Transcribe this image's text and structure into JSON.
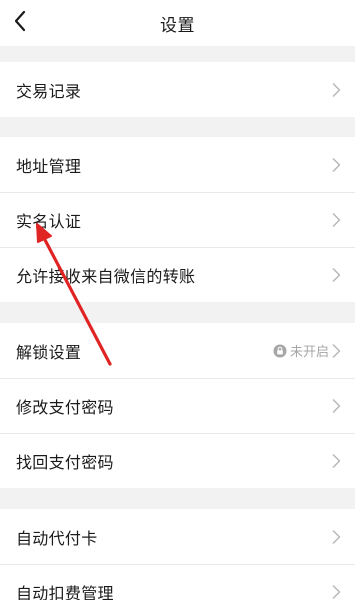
{
  "header": {
    "title": "设置",
    "back_icon": "chevron-left-icon"
  },
  "groups": [
    {
      "items": [
        {
          "label": "交易记录"
        }
      ]
    },
    {
      "items": [
        {
          "label": "地址管理"
        },
        {
          "label": "实名认证"
        },
        {
          "label": "允许接收来自微信的转账"
        }
      ]
    },
    {
      "items": [
        {
          "label": "解锁设置",
          "status": "未开启",
          "status_icon": "lock-icon"
        },
        {
          "label": "修改支付密码"
        },
        {
          "label": "找回支付密码"
        }
      ]
    },
    {
      "items": [
        {
          "label": "自动代付卡"
        },
        {
          "label": "自动扣费管理"
        }
      ]
    }
  ],
  "colors": {
    "background": "#f2f2f2",
    "row_background": "#ffffff",
    "chevron": "#b5b5b5",
    "annotation_arrow": "#e02424"
  }
}
